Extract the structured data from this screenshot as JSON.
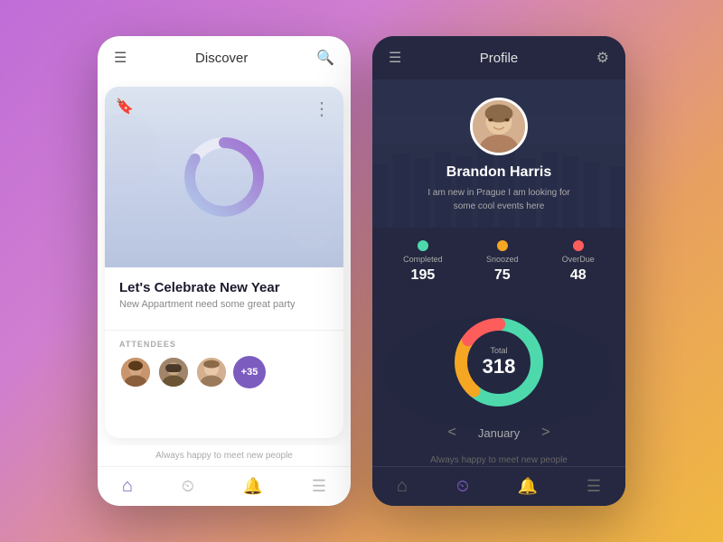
{
  "background": {
    "gradient": "135deg, #c06dd8 0%, #d07ed0 30%, #e8a060 70%, #f0b840 100%"
  },
  "discover_screen": {
    "header": {
      "title": "Discover",
      "menu_icon": "☰",
      "search_icon": "🔍"
    },
    "event_card": {
      "bookmark_icon": "🔖",
      "dots_icon": "⋮",
      "title": "Let's Celebrate New Year",
      "subtitle": "New Appartment need some great party",
      "attendees_label": "ATTENDEES",
      "attendees_count": "+35"
    },
    "footer_text": "Always happy to meet new people",
    "bottom_nav": {
      "items": [
        {
          "icon": "⌂",
          "label": "home",
          "active": true
        },
        {
          "icon": "⏲",
          "label": "timer",
          "active": false
        },
        {
          "icon": "🔔",
          "label": "notifications",
          "active": false
        },
        {
          "icon": "☰",
          "label": "menu",
          "active": false
        }
      ]
    }
  },
  "profile_screen": {
    "header": {
      "title": "Profile",
      "menu_icon": "☰",
      "filter_icon": "⚙"
    },
    "user": {
      "name": "Brandon Harris",
      "bio": "I am new in Prague I am looking for some cool events here"
    },
    "stats": [
      {
        "label": "Completed",
        "value": "195",
        "color": "#4dd9ac",
        "dot_color": "#4dd9ac"
      },
      {
        "label": "Snoozed",
        "value": "75",
        "color": "#f5a623",
        "dot_color": "#f5a623"
      },
      {
        "label": "OverDue",
        "value": "48",
        "color": "#ff5c5c",
        "dot_color": "#ff5c5c"
      }
    ],
    "chart": {
      "total_label": "Total",
      "total_value": "318",
      "segments": [
        {
          "color": "#4dd9ac",
          "value": 195,
          "percent": 61.3
        },
        {
          "color": "#f5a623",
          "value": 75,
          "percent": 23.6
        },
        {
          "color": "#ff5c5c",
          "value": 48,
          "percent": 15.1
        }
      ]
    },
    "month_nav": {
      "prev_icon": "<",
      "next_icon": ">",
      "current_month": "January"
    },
    "footer_text": "Always happy to meet new people",
    "bottom_nav": {
      "items": [
        {
          "icon": "⌂",
          "label": "home",
          "active": false
        },
        {
          "icon": "⏲",
          "label": "timer",
          "active": true
        },
        {
          "icon": "🔔",
          "label": "notifications",
          "active": false
        },
        {
          "icon": "☰",
          "label": "menu",
          "active": false
        }
      ]
    }
  }
}
